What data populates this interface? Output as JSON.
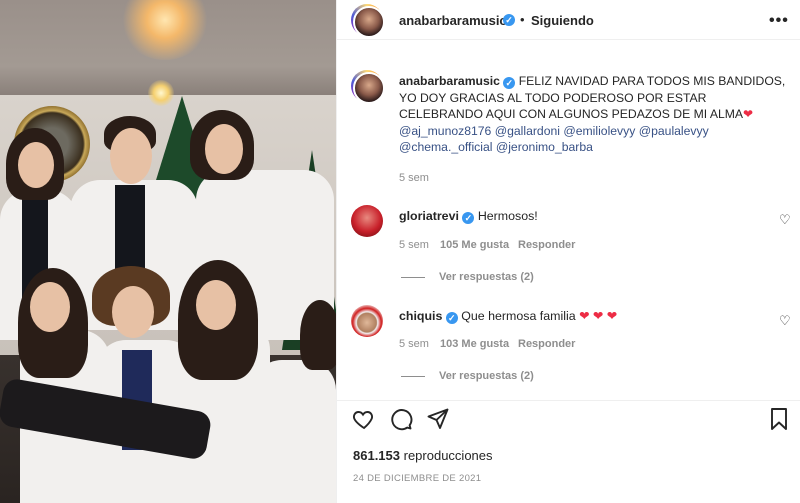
{
  "post": {
    "username": "anabarbaramusic",
    "separator": "•",
    "follow_label": "Siguiendo",
    "more_icon": "more-horizontal-icon",
    "caption_text": "FELIZ NAVIDAD PARA TODOS MIS BANDIDOS, YO DOY GRACIAS AL TODO PODEROSO POR ESTAR CELEBRANDO AQUI CON ALGUNOS PEDAZOS DE MI ALMA",
    "caption_heart": "❤",
    "mentions": [
      "@aj_munoz8176",
      "@gallardoni",
      "@emiliolevyy",
      "@paulalevyy",
      "@chema._official",
      "@jeronimo_barba"
    ],
    "caption_time": "5 sem",
    "colors": {
      "link": "#385185",
      "verified": "#3897f0",
      "heart": "#ed2c45",
      "muted": "#8e8e8e"
    }
  },
  "comments": [
    {
      "username": "gloriatrevi",
      "text": "Hermosos!",
      "time": "5 sem",
      "likes": "105 Me gusta",
      "reply_label": "Responder",
      "view_replies": "Ver respuestas (2)"
    },
    {
      "username": "chiquis",
      "text": "Que hermosa familia",
      "hearts": "❤ ❤ ❤",
      "time": "5 sem",
      "likes": "103 Me gusta",
      "reply_label": "Responder",
      "view_replies": "Ver respuestas (2)"
    }
  ],
  "footer": {
    "views_count": "861.153",
    "views_label": "reproducciones",
    "date": "24 DE DICIEMBRE DE 2021",
    "icons": [
      "heart-icon",
      "comment-icon",
      "share-icon",
      "bookmark-icon"
    ]
  }
}
